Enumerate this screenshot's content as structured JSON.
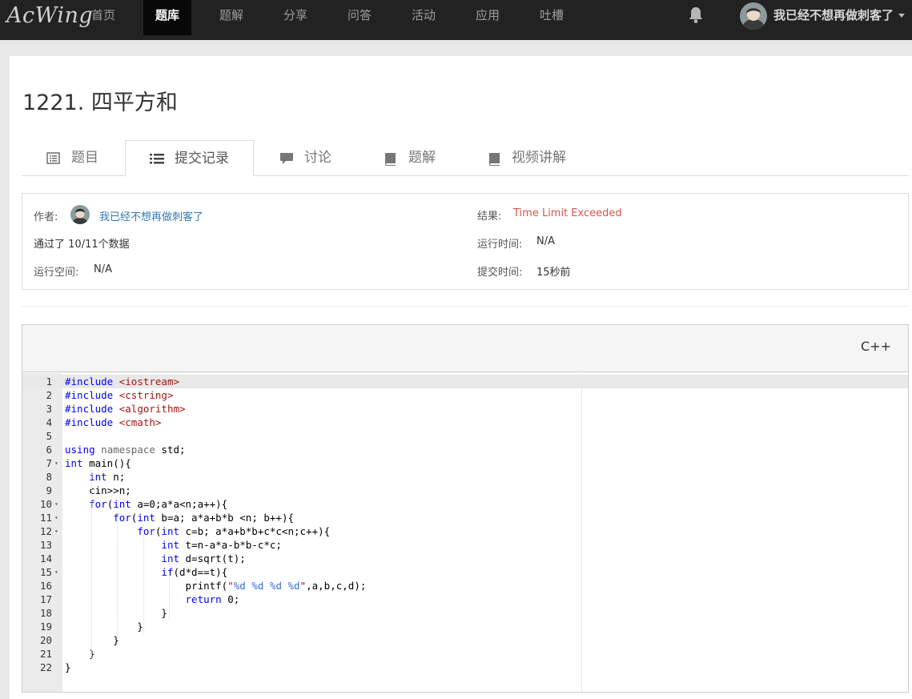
{
  "navbar": {
    "logo": "AcWing",
    "items": [
      "首页",
      "题库",
      "题解",
      "分享",
      "问答",
      "活动",
      "应用",
      "吐槽"
    ],
    "active": "题库",
    "username": "我已经不想再做刺客了"
  },
  "problem": {
    "title": "1221. 四平方和"
  },
  "tabs": [
    {
      "label": "题目",
      "icon": "list-alt-icon"
    },
    {
      "label": "提交记录",
      "icon": "list-icon"
    },
    {
      "label": "讨论",
      "icon": "comment-icon"
    },
    {
      "label": "题解",
      "icon": "book-icon"
    },
    {
      "label": "视频讲解",
      "icon": "book-icon"
    }
  ],
  "submission": {
    "author_label": "作者:",
    "author": "我已经不想再做刺客了",
    "passed_prefix": "通过了",
    "passed": "10/11",
    "passed_suffix": "个数据",
    "memory_label": "运行空间:",
    "memory": "N/A",
    "result_label": "结果:",
    "result": "Time Limit Exceeded",
    "time_label": "运行时间:",
    "time": "N/A",
    "submit_time_label": "提交时间:",
    "submit_time": "15秒前"
  },
  "code": {
    "language": "C++",
    "lines": [
      "#include <iostream>",
      "#include <cstring>",
      "#include <algorithm>",
      "#include <cmath>",
      "",
      "using namespace std;",
      "int main(){",
      "    int n;",
      "    cin>>n;",
      "    for(int a=0;a*a<n;a++){",
      "        for(int b=a; a*a+b*b <n; b++){",
      "            for(int c=b; a*a+b*b+c*c<n;c++){",
      "                int t=n-a*a-b*b-c*c;",
      "                int d=sqrt(t);",
      "                if(d*d==t){",
      "                    printf(\"%d %d %d %d\",a,b,c,d);",
      "                    return 0;",
      "                }",
      "            }",
      "        }",
      "    }",
      "}"
    ],
    "fold_lines": [
      7,
      10,
      11,
      12,
      15
    ]
  },
  "colors": {
    "navbar_bg": "#222222",
    "link": "#337ab7",
    "tle": "#d9534f",
    "keyword": "#0000ff",
    "string": "#a31515"
  }
}
